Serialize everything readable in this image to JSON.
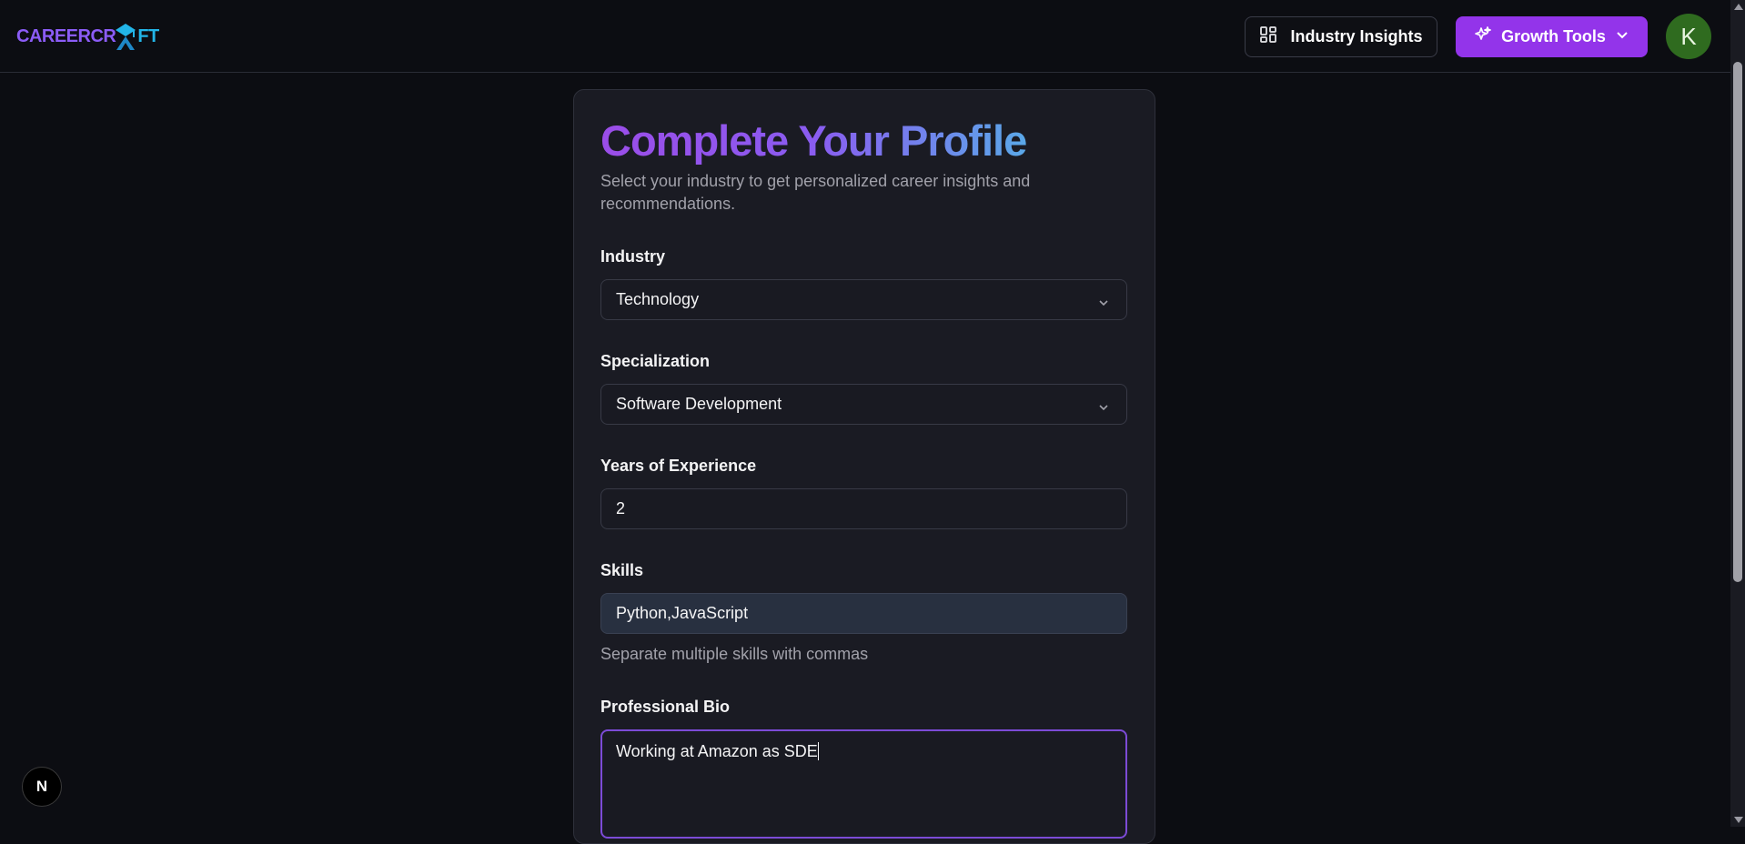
{
  "app": {
    "logo_part1": "CAREERCR",
    "logo_part2": "FT",
    "colors": {
      "accent": "#9334ea",
      "logo_purple": "#8b5cf6",
      "logo_blue": "#22b5e8",
      "avatar_bg": "#2f6b1f"
    }
  },
  "header": {
    "insights_label": "Industry Insights",
    "insights_icon": "dashboard-grid-icon",
    "growth_label": "Growth Tools",
    "growth_icon": "sparkles-icon",
    "avatar_initial": "K"
  },
  "form": {
    "title": "Complete Your Profile",
    "subtitle": "Select your industry to get personalized career insights and recommendations.",
    "industry": {
      "label": "Industry",
      "value": "Technology"
    },
    "specialization": {
      "label": "Specialization",
      "value": "Software Development"
    },
    "experience": {
      "label": "Years of Experience",
      "value": "2"
    },
    "skills": {
      "label": "Skills",
      "value": "Python,JavaScript",
      "hint": "Separate multiple skills with commas"
    },
    "bio": {
      "label": "Professional Bio",
      "value": "Working at Amazon as SDE"
    }
  },
  "dev_badge": {
    "letter": "N"
  }
}
